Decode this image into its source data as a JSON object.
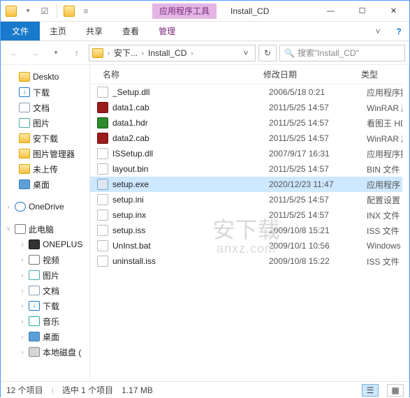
{
  "window": {
    "context_tool": "应用程序工具",
    "title": "Install_CD"
  },
  "ribbon": {
    "file": "文件",
    "tabs": [
      "主页",
      "共享",
      "查看"
    ],
    "context_tab": "管理"
  },
  "nav": {
    "crumbs": [
      "安下...",
      "Install_CD"
    ],
    "refresh_title": "刷新",
    "search_placeholder": "搜索\"Install_CD\""
  },
  "tree": {
    "top": [
      {
        "label": "Deskto",
        "icon": "folder"
      },
      {
        "label": "下载",
        "icon": "dl"
      },
      {
        "label": "文档",
        "icon": "doc"
      },
      {
        "label": "图片",
        "icon": "pic"
      },
      {
        "label": "安下载",
        "icon": "folder"
      },
      {
        "label": "图片管理器",
        "icon": "folder"
      },
      {
        "label": "未上传",
        "icon": "folder"
      },
      {
        "label": "桌面",
        "icon": "desk"
      }
    ],
    "onedrive": "OneDrive",
    "pc": "此电脑",
    "pc_children": [
      {
        "label": "ONEPLUS",
        "icon": "phone"
      },
      {
        "label": "视频",
        "icon": "video"
      },
      {
        "label": "图片",
        "icon": "pic"
      },
      {
        "label": "文档",
        "icon": "doc"
      },
      {
        "label": "下载",
        "icon": "dl"
      },
      {
        "label": "音乐",
        "icon": "music"
      },
      {
        "label": "桌面",
        "icon": "desk"
      },
      {
        "label": "本地磁盘 (",
        "icon": "disk"
      }
    ]
  },
  "columns": {
    "name": "名称",
    "date": "修改日期",
    "type": "类型"
  },
  "files": [
    {
      "icon": "dll",
      "name": "_Setup.dll",
      "date": "2006/5/18 0:21",
      "type": "应用程序扩"
    },
    {
      "icon": "rar",
      "name": "data1.cab",
      "date": "2011/5/25 14:57",
      "type": "WinRAR 压"
    },
    {
      "icon": "hdr",
      "name": "data1.hdr",
      "date": "2011/5/25 14:57",
      "type": "看图王 HD"
    },
    {
      "icon": "rar",
      "name": "data2.cab",
      "date": "2011/5/25 14:57",
      "type": "WinRAR 压"
    },
    {
      "icon": "dll",
      "name": "ISSetup.dll",
      "date": "2007/9/17 16:31",
      "type": "应用程序扩"
    },
    {
      "icon": "bin",
      "name": "layout.bin",
      "date": "2011/5/25 14:57",
      "type": "BIN 文件"
    },
    {
      "icon": "exe",
      "name": "setup.exe",
      "date": "2020/12/23 11:47",
      "type": "应用程序",
      "selected": true
    },
    {
      "icon": "ini",
      "name": "setup.ini",
      "date": "2011/5/25 14:57",
      "type": "配置设置"
    },
    {
      "icon": "txt",
      "name": "setup.inx",
      "date": "2011/5/25 14:57",
      "type": "INX 文件"
    },
    {
      "icon": "txt",
      "name": "setup.iss",
      "date": "2009/10/8 15:21",
      "type": "ISS 文件"
    },
    {
      "icon": "bat",
      "name": "UnInst.bat",
      "date": "2009/10/1 10:56",
      "type": "Windows"
    },
    {
      "icon": "txt",
      "name": "uninstall.iss",
      "date": "2009/10/8 15:22",
      "type": "ISS 文件"
    }
  ],
  "status": {
    "count": "12 个项目",
    "selection": "选中 1 个项目",
    "size": "1.17 MB"
  },
  "watermark": {
    "big": "安下载",
    "small": "anxz.com"
  }
}
